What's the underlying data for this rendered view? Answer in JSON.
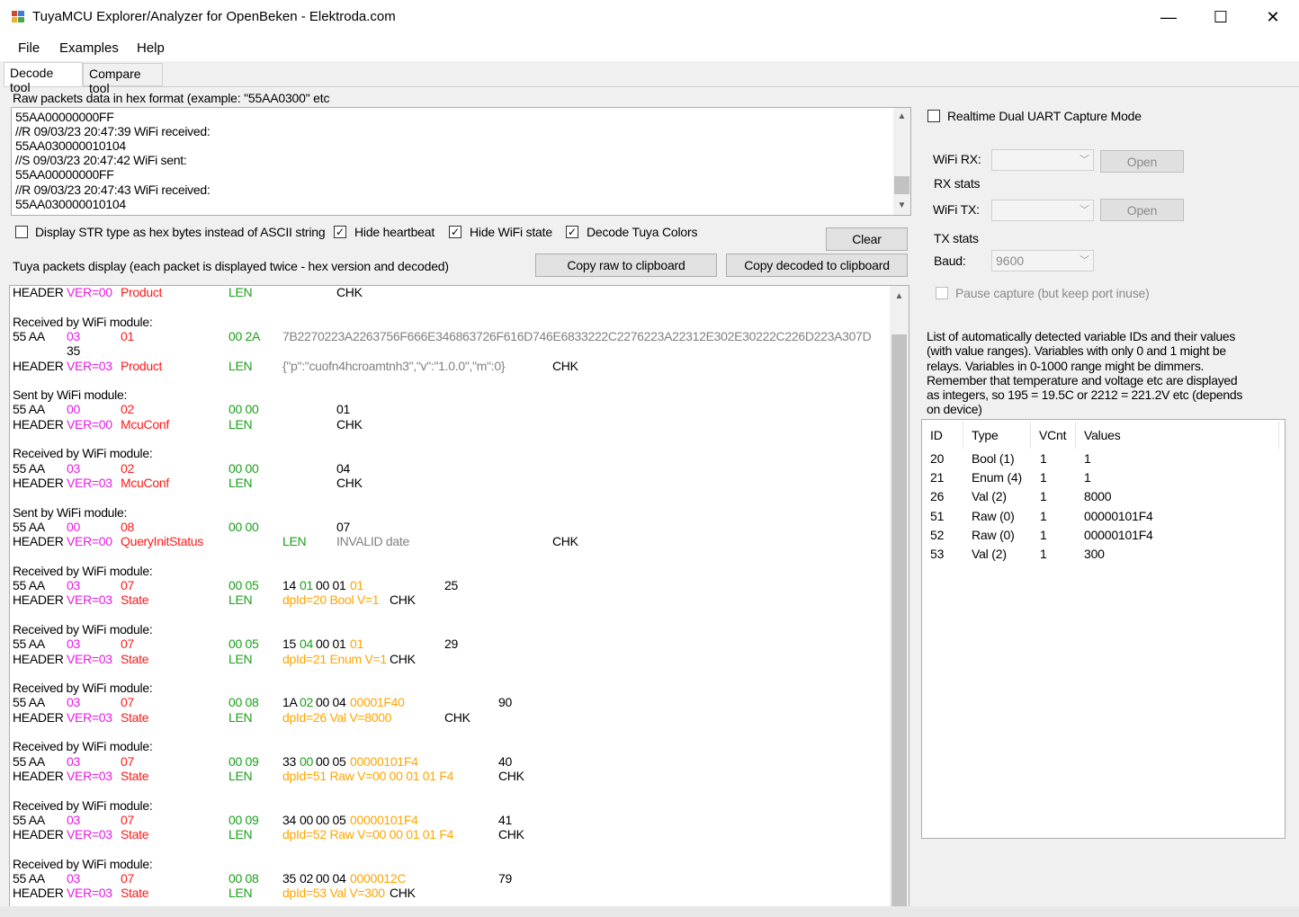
{
  "window": {
    "title": "TuyaMCU Explorer/Analyzer for OpenBeken - Elektroda.com",
    "minimize": "—",
    "maximize": "☐",
    "close": "✕"
  },
  "menu": [
    "File",
    "Examples",
    "Help"
  ],
  "tabs": [
    "Decode tool",
    "Compare tool"
  ],
  "raw": {
    "label": "Raw packets data in hex format (example: \"55AA0300\" etc",
    "lines": [
      "55AA00000000FF",
      "//R 09/03/23 20:47:39 WiFi received:",
      "55AA030000010104",
      "//S 09/03/23 20:47:42 WiFi sent:",
      "55AA00000000FF",
      "//R 09/03/23 20:47:43 WiFi received:",
      "55AA030000010104"
    ]
  },
  "options": {
    "display_str_hex": {
      "label": "Display STR type as hex bytes instead of ASCII string",
      "checked": false
    },
    "hide_heartbeat": {
      "label": "Hide heartbeat",
      "checked": true
    },
    "hide_wifi_state": {
      "label": "Hide WiFi state",
      "checked": true
    },
    "decode_colors": {
      "label": "Decode Tuya Colors",
      "checked": true
    }
  },
  "buttons": {
    "clear": "Clear",
    "copy_raw": "Copy raw to clipboard",
    "copy_decoded": "Copy decoded to clipboard"
  },
  "packets_label": "Tuya packets display (each packet is displayed twice - hex version and decoded)",
  "packets": [
    {
      "rows": [
        [
          [
            "HEADER",
            "black",
            0
          ],
          [
            "VER=00",
            "mag",
            60
          ],
          [
            "Product",
            "red",
            120
          ],
          [
            "LEN",
            "green",
            240
          ],
          [
            "CHK",
            "black",
            360
          ]
        ]
      ],
      "clipped": true
    },
    {
      "rows": [
        [
          [
            "Received by WiFi module:",
            "black",
            0
          ]
        ],
        [
          [
            "55 AA",
            "black",
            0
          ],
          [
            "03",
            "mag",
            60
          ],
          [
            "01",
            "red",
            120
          ],
          [
            "00 2A",
            "green",
            240
          ],
          [
            "7B2270223A2263756F666E346863726F616D746E6833222C2276223A22312E302E30222C226D223A307D",
            "gray",
            300
          ]
        ],
        [
          [
            "35",
            "black",
            60
          ]
        ],
        [
          [
            "HEADER",
            "black",
            0
          ],
          [
            "VER=03",
            "mag",
            60
          ],
          [
            "Product",
            "red",
            120
          ],
          [
            "LEN",
            "green",
            240
          ],
          [
            "{\"p\":\"cuofn4hcroamtnh3\",\"v\":\"1.0.0\",\"m\":0}",
            "gray",
            300
          ],
          [
            "CHK",
            "black",
            600
          ]
        ]
      ]
    },
    {
      "rows": [
        [
          [
            "Sent by WiFi module:",
            "black",
            0
          ]
        ],
        [
          [
            "55 AA",
            "black",
            0
          ],
          [
            "00",
            "mag",
            60
          ],
          [
            "02",
            "red",
            120
          ],
          [
            "00 00",
            "green",
            240
          ],
          [
            "01",
            "black",
            360
          ]
        ],
        [
          [
            "HEADER",
            "black",
            0
          ],
          [
            "VER=00",
            "mag",
            60
          ],
          [
            "McuConf",
            "red",
            120
          ],
          [
            "LEN",
            "green",
            240
          ],
          [
            "CHK",
            "black",
            360
          ]
        ]
      ]
    },
    {
      "rows": [
        [
          [
            "Received by WiFi module:",
            "black",
            0
          ]
        ],
        [
          [
            "55 AA",
            "black",
            0
          ],
          [
            "03",
            "mag",
            60
          ],
          [
            "02",
            "red",
            120
          ],
          [
            "00 00",
            "green",
            240
          ],
          [
            "04",
            "black",
            360
          ]
        ],
        [
          [
            "HEADER",
            "black",
            0
          ],
          [
            "VER=03",
            "mag",
            60
          ],
          [
            "McuConf",
            "red",
            120
          ],
          [
            "LEN",
            "green",
            240
          ],
          [
            "CHK",
            "black",
            360
          ]
        ]
      ]
    },
    {
      "rows": [
        [
          [
            "Sent by WiFi module:",
            "black",
            0
          ]
        ],
        [
          [
            "55 AA",
            "black",
            0
          ],
          [
            "00",
            "mag",
            60
          ],
          [
            "08",
            "red",
            120
          ],
          [
            "00 00",
            "green",
            240
          ],
          [
            "07",
            "black",
            360
          ]
        ],
        [
          [
            "HEADER",
            "black",
            0
          ],
          [
            "VER=00",
            "mag",
            60
          ],
          [
            "QueryInitStatus",
            "red",
            120
          ],
          [
            "LEN",
            "green",
            300
          ],
          [
            "INVALID date",
            "gray",
            360
          ],
          [
            "CHK",
            "black",
            600
          ]
        ]
      ]
    },
    {
      "rows": [
        [
          [
            "Received by WiFi module:",
            "black",
            0
          ]
        ],
        [
          [
            "55 AA",
            "black",
            0
          ],
          [
            "03",
            "mag",
            60
          ],
          [
            "07",
            "red",
            120
          ],
          [
            "00 05",
            "green",
            240
          ],
          [
            "14 ",
            "black",
            300
          ],
          [
            "01 ",
            "green",
            320
          ],
          [
            "00 01 ",
            "black",
            340
          ],
          [
            "01",
            "orange",
            375
          ],
          [
            "25",
            "black",
            480
          ]
        ],
        [
          [
            "HEADER",
            "black",
            0
          ],
          [
            "VER=03",
            "mag",
            60
          ],
          [
            "State",
            "red",
            120
          ],
          [
            "LEN",
            "green",
            240
          ],
          [
            "dpId=20 Bool V=1",
            "orange",
            300
          ],
          [
            "CHK",
            "black",
            420
          ]
        ]
      ]
    },
    {
      "rows": [
        [
          [
            "Received by WiFi module:",
            "black",
            0
          ]
        ],
        [
          [
            "55 AA",
            "black",
            0
          ],
          [
            "03",
            "mag",
            60
          ],
          [
            "07",
            "red",
            120
          ],
          [
            "00 05",
            "green",
            240
          ],
          [
            "15 ",
            "black",
            300
          ],
          [
            "04 ",
            "green",
            320
          ],
          [
            "00 01 ",
            "black",
            340
          ],
          [
            "01",
            "orange",
            375
          ],
          [
            "29",
            "black",
            480
          ]
        ],
        [
          [
            "HEADER",
            "black",
            0
          ],
          [
            "VER=03",
            "mag",
            60
          ],
          [
            "State",
            "red",
            120
          ],
          [
            "LEN",
            "green",
            240
          ],
          [
            "dpId=21 Enum V=1",
            "orange",
            300
          ],
          [
            "CHK",
            "black",
            420
          ]
        ]
      ]
    },
    {
      "rows": [
        [
          [
            "Received by WiFi module:",
            "black",
            0
          ]
        ],
        [
          [
            "55 AA",
            "black",
            0
          ],
          [
            "03",
            "mag",
            60
          ],
          [
            "07",
            "red",
            120
          ],
          [
            "00 08",
            "green",
            240
          ],
          [
            "1A ",
            "black",
            300
          ],
          [
            "02 ",
            "green",
            320
          ],
          [
            "00 04 ",
            "black",
            340
          ],
          [
            "00001F40",
            "orange",
            375
          ],
          [
            "90",
            "black",
            540
          ]
        ],
        [
          [
            "HEADER",
            "black",
            0
          ],
          [
            "VER=03",
            "mag",
            60
          ],
          [
            "State",
            "red",
            120
          ],
          [
            "LEN",
            "green",
            240
          ],
          [
            "dpId=26 Val V=8000",
            "orange",
            300
          ],
          [
            "CHK",
            "black",
            480
          ]
        ]
      ]
    },
    {
      "rows": [
        [
          [
            "Received by WiFi module:",
            "black",
            0
          ]
        ],
        [
          [
            "55 AA",
            "black",
            0
          ],
          [
            "03",
            "mag",
            60
          ],
          [
            "07",
            "red",
            120
          ],
          [
            "00 09",
            "green",
            240
          ],
          [
            "33 ",
            "black",
            300
          ],
          [
            "00 ",
            "green",
            320
          ],
          [
            "00 05 ",
            "black",
            340
          ],
          [
            "00000101F4",
            "orange",
            375
          ],
          [
            "40",
            "black",
            540
          ]
        ],
        [
          [
            "HEADER",
            "black",
            0
          ],
          [
            "VER=03",
            "mag",
            60
          ],
          [
            "State",
            "red",
            120
          ],
          [
            "LEN",
            "green",
            240
          ],
          [
            "dpId=51 Raw V=00 00 01 01 F4",
            "orange",
            300
          ],
          [
            "CHK",
            "black",
            540
          ]
        ]
      ]
    },
    {
      "rows": [
        [
          [
            "Received by WiFi module:",
            "black",
            0
          ]
        ],
        [
          [
            "55 AA",
            "black",
            0
          ],
          [
            "03",
            "mag",
            60
          ],
          [
            "07",
            "red",
            120
          ],
          [
            "00 09",
            "green",
            240
          ],
          [
            "34 ",
            "black",
            300
          ],
          [
            "00 ",
            "black",
            320
          ],
          [
            "00 05 ",
            "black",
            340
          ],
          [
            "00000101F4",
            "orange",
            375
          ],
          [
            "41",
            "black",
            540
          ]
        ],
        [
          [
            "HEADER",
            "black",
            0
          ],
          [
            "VER=03",
            "mag",
            60
          ],
          [
            "State",
            "red",
            120
          ],
          [
            "LEN",
            "green",
            240
          ],
          [
            "dpId=52 Raw V=00 00 01 01 F4",
            "orange",
            300
          ],
          [
            "CHK",
            "black",
            540
          ]
        ]
      ]
    },
    {
      "rows": [
        [
          [
            "Received by WiFi module:",
            "black",
            0
          ]
        ],
        [
          [
            "55 AA",
            "black",
            0
          ],
          [
            "03",
            "mag",
            60
          ],
          [
            "07",
            "red",
            120
          ],
          [
            "00 08",
            "green",
            240
          ],
          [
            "35 ",
            "black",
            300
          ],
          [
            "02 ",
            "black",
            320
          ],
          [
            "00 04 ",
            "black",
            340
          ],
          [
            "0000012C",
            "orange",
            375
          ],
          [
            "79",
            "black",
            540
          ]
        ],
        [
          [
            "HEADER",
            "black",
            0
          ],
          [
            "VER=03",
            "mag",
            60
          ],
          [
            "State",
            "red",
            120
          ],
          [
            "LEN",
            "green",
            240
          ],
          [
            "dpId=53 Val V=300",
            "orange",
            300
          ],
          [
            "CHK",
            "black",
            420
          ]
        ]
      ]
    }
  ],
  "uart": {
    "realtime_label": "Realtime Dual UART Capture Mode",
    "wifi_rx_label": "WiFi RX:",
    "rx_stats": "RX stats",
    "wifi_tx_label": "WiFi TX:",
    "tx_stats": "TX stats",
    "baud_label": "Baud:",
    "baud_value": "9600",
    "open": "Open",
    "pause_label": "Pause capture (but keep port inuse)"
  },
  "vars": {
    "description": [
      "List of automatically detected variable IDs  and their values",
      "(with value ranges). Variables with only 0 and 1 might be",
      "relays. Variables in 0-1000 range might be dimmers.",
      "Remember that temperature and voltage etc are displayed",
      "as integers, so 195 = 19.5C or 2212 = 221.2V etc (depends",
      "on device)"
    ],
    "columns": [
      "ID",
      "Type",
      "VCnt",
      "Values"
    ],
    "rows": [
      [
        "20",
        "Bool (1)",
        "1",
        "1"
      ],
      [
        "21",
        "Enum (4)",
        "1",
        "1"
      ],
      [
        "26",
        "Val (2)",
        "1",
        "8000"
      ],
      [
        "51",
        "Raw (0)",
        "1",
        "00000101F4"
      ],
      [
        "52",
        "Raw (0)",
        "1",
        "00000101F4"
      ],
      [
        "53",
        "Val (2)",
        "1",
        "300"
      ]
    ]
  },
  "colors": {
    "magenta": "#e81be6",
    "red": "#ff1a1a",
    "green": "#1aa01a",
    "gray": "#808080",
    "orange": "#ffa500"
  }
}
